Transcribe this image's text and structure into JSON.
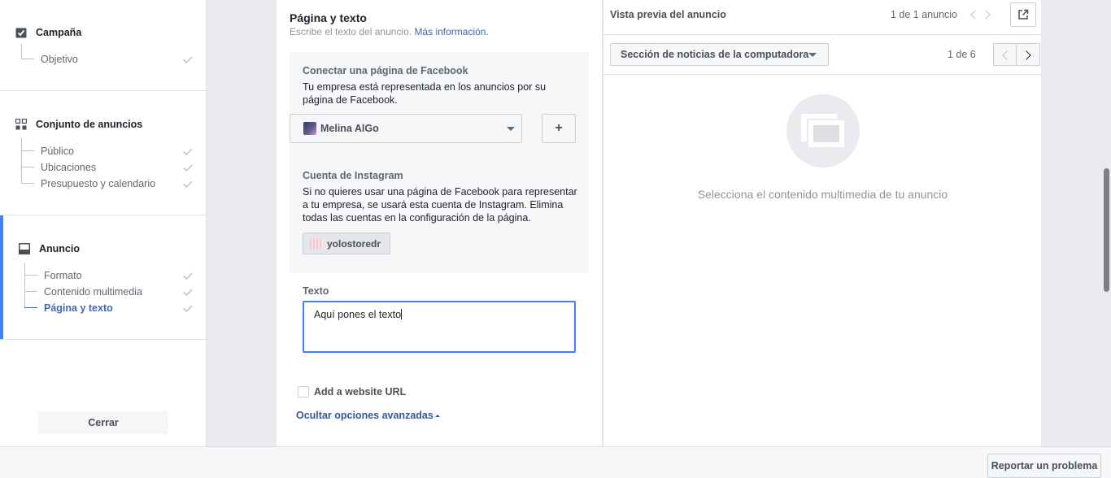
{
  "nav": {
    "campaign": {
      "title": "Campaña",
      "items": [
        {
          "label": "Objetivo",
          "done": true
        }
      ]
    },
    "adset": {
      "title": "Conjunto de anuncios",
      "items": [
        {
          "label": "Público",
          "done": true
        },
        {
          "label": "Ubicaciones",
          "done": true
        },
        {
          "label": "Presupuesto y calendario",
          "done": true
        }
      ]
    },
    "ad": {
      "title": "Anuncio",
      "items": [
        {
          "label": "Formato",
          "done": true
        },
        {
          "label": "Contenido multimedia",
          "done": true
        },
        {
          "label": "Página y texto",
          "done": true,
          "current": true
        }
      ]
    },
    "close_label": "Cerrar"
  },
  "editor": {
    "title": "Página y texto",
    "subtitle": "Escribe el texto del anuncio.",
    "more_info": "Más información.",
    "facebook_page": {
      "label": "Conectar una página de Facebook",
      "description": "Tu empresa está representada en los anuncios por su página de Facebook.",
      "selected_page": "Melina AlGo",
      "add_label": "+"
    },
    "instagram": {
      "label": "Cuenta de Instagram",
      "description": "Si no quieres usar una página de Facebook para representar a tu empresa, se usará esta cuenta de Instagram. Elimina todas las cuentas en la configuración de la página.",
      "account": "yolostoredr"
    },
    "text": {
      "label": "Texto",
      "value": "Aquí pones el texto"
    },
    "website_checkbox": {
      "label": "Add a website URL",
      "checked": false
    },
    "advanced_link": "Ocultar opciones avanzadas"
  },
  "preview": {
    "title": "Vista previa del anuncio",
    "ad_count": "1 de 1 anuncio",
    "placement": "Sección de noticias de la computadora",
    "page_count": "1 de 6",
    "empty_message": "Selecciona el contenido multimedia de tu anuncio"
  },
  "footer": {
    "report_label": "Reportar un problema"
  },
  "colors": {
    "accent": "#4080ff",
    "link": "#4267b2",
    "check": "#bec3c9"
  },
  "icons": [
    "checkbox-icon",
    "grid-icon",
    "ad-icon",
    "check-icon",
    "caret-down-icon",
    "chevron-left-icon",
    "chevron-right-icon",
    "external-link-icon",
    "media-placeholder-icon"
  ]
}
